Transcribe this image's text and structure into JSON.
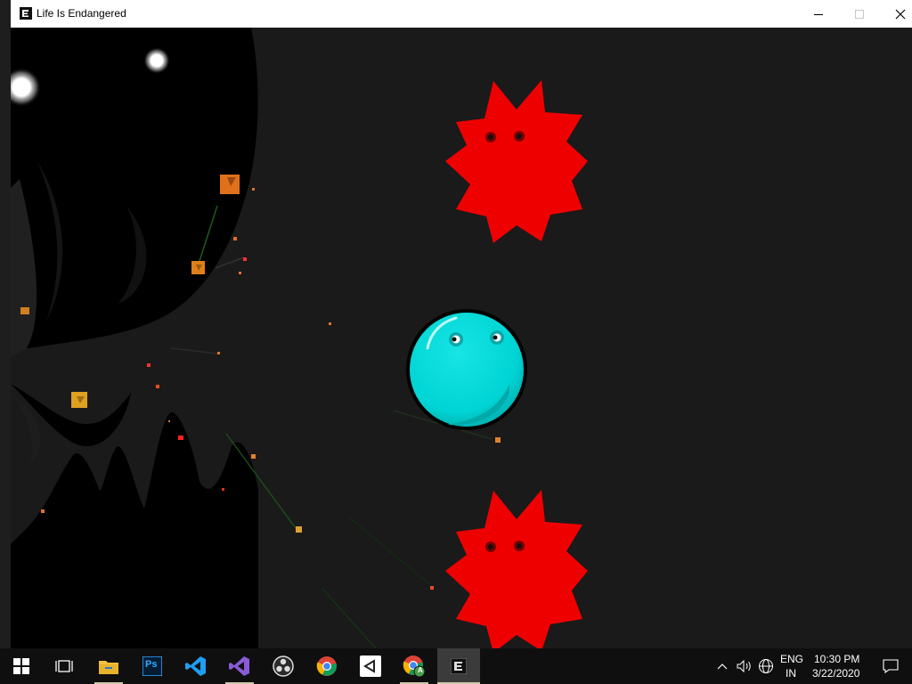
{
  "window": {
    "title": "Life Is Endangered",
    "controls": [
      "minimize",
      "maximize",
      "close"
    ]
  },
  "game": {
    "player": {
      "color": "#00d7d7"
    },
    "enemies": [
      {
        "color": "#ee0000"
      },
      {
        "color": "#ee0000"
      }
    ]
  },
  "taskbar": {
    "apps": [
      {
        "name": "start-icon",
        "icon": "windows"
      },
      {
        "name": "task-view-icon",
        "icon": "task-view"
      },
      {
        "name": "file-explorer-icon",
        "icon": "folder"
      },
      {
        "name": "photoshop-icon",
        "icon": "photoshop",
        "label": "Ps"
      },
      {
        "name": "vscode-icon",
        "icon": "vscode"
      },
      {
        "name": "visual-studio-icon",
        "icon": "visual-studio"
      },
      {
        "name": "obs-icon",
        "icon": "obs"
      },
      {
        "name": "chrome-icon",
        "icon": "chrome"
      },
      {
        "name": "unity-icon",
        "icon": "unity"
      },
      {
        "name": "chrome-profile-icon",
        "icon": "chrome",
        "badge": "A"
      },
      {
        "name": "game-app-icon",
        "icon": "game",
        "active": true
      }
    ],
    "tray": {
      "language_top": "ENG",
      "language_bottom": "IN",
      "time": "10:30 PM",
      "date": "3/22/2020"
    }
  }
}
